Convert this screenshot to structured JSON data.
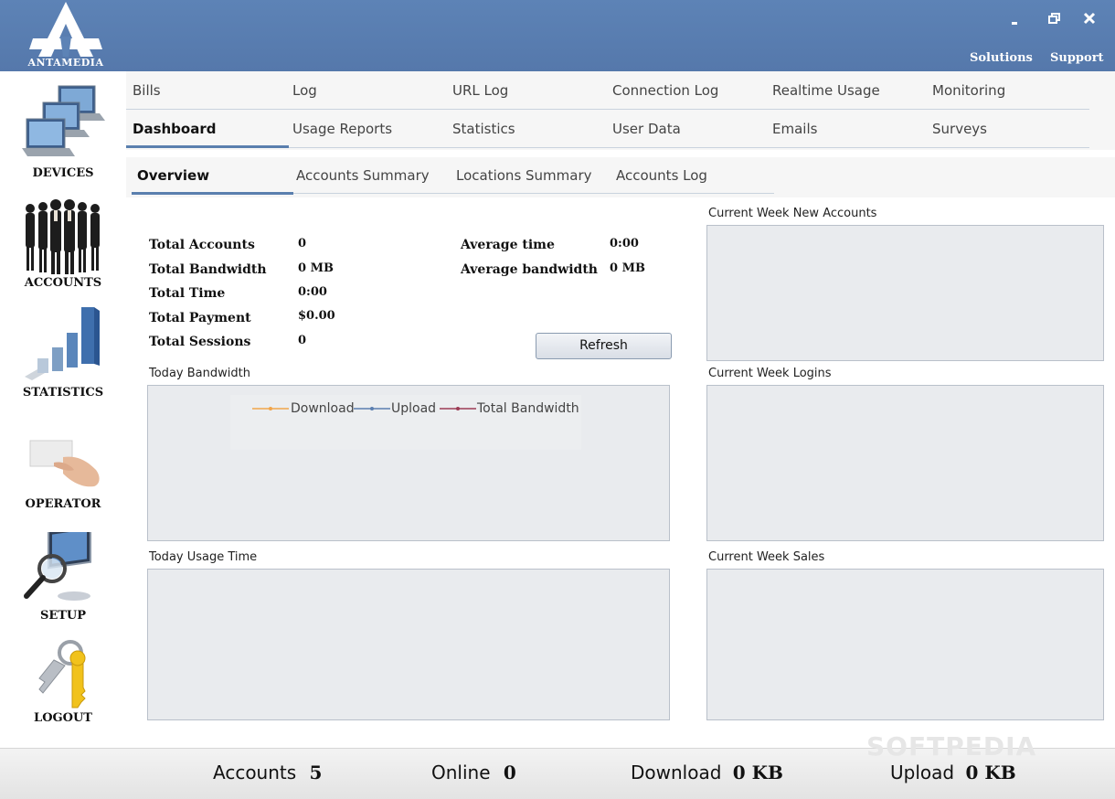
{
  "app": {
    "logo_text": "ANTAMEDIA",
    "links": {
      "solutions": "Solutions",
      "support": "Support"
    }
  },
  "sidebar": {
    "devices": "DEVICES",
    "accounts": "ACCOUNTS",
    "statistics": "STATISTICS",
    "operator": "OPERATOR",
    "setup": "SETUP",
    "logout": "LOGOUT"
  },
  "nav": {
    "row1": [
      "Bills",
      "Log",
      "URL Log",
      "Connection Log",
      "Realtime Usage",
      "Monitoring"
    ],
    "row2": [
      "Dashboard",
      "Usage Reports",
      "Statistics",
      "User Data",
      "Emails",
      "Surveys"
    ],
    "active": "Dashboard"
  },
  "subtabs": {
    "items": [
      "Overview",
      "Accounts Summary",
      "Locations Summary",
      "Accounts Log"
    ],
    "active": "Overview"
  },
  "stats": {
    "total_accounts": {
      "label": "Total Accounts",
      "value": "0"
    },
    "total_bandwidth": {
      "label": "Total Bandwidth",
      "value": "0 MB"
    },
    "total_time": {
      "label": "Total Time",
      "value": "0:00"
    },
    "total_payment": {
      "label": "Total Payment",
      "value": "$0.00"
    },
    "total_sessions": {
      "label": "Total Sessions",
      "value": "0"
    },
    "average_time": {
      "label": "Average time",
      "value": "0:00"
    },
    "average_bandwidth": {
      "label": "Average bandwidth",
      "value": "0 MB"
    }
  },
  "buttons": {
    "refresh": "Refresh"
  },
  "panels": {
    "today_bandwidth": "Today Bandwidth",
    "today_usage_time": "Today Usage Time",
    "week_new_accounts": "Current Week New Accounts",
    "week_logins": "Current Week Logins",
    "week_sales": "Current Week Sales"
  },
  "legend": {
    "download": "Download",
    "upload": "Upload",
    "total": "Total Bandwidth",
    "colors": {
      "download": "#f2a54a",
      "upload": "#5b7fb0",
      "total": "#9c3c55"
    }
  },
  "status": {
    "accounts_label": "Accounts",
    "accounts_value": "5",
    "online_label": "Online",
    "online_value": "0",
    "download_label": "Download",
    "download_value": "0 KB",
    "upload_label": "Upload",
    "upload_value": "0 KB"
  },
  "watermark": "SOFTPEDIA"
}
